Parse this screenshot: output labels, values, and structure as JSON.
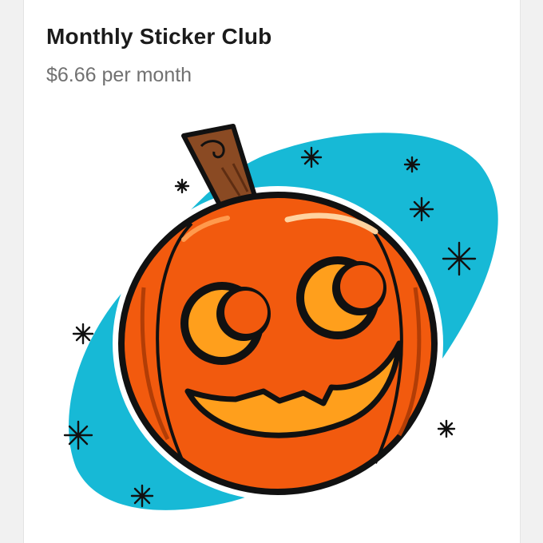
{
  "product": {
    "title": "Monthly Sticker Club",
    "price": "$6.66 per month"
  },
  "image": {
    "subject": "jack-o-lantern-sticker",
    "colors": {
      "background_blob": "#17b9d6",
      "pumpkin": "#f25a0e",
      "pumpkin_highlight": "#ff8a3a",
      "glow": "#ff9f1c",
      "stem": "#8a4a23",
      "outline": "#111111"
    }
  }
}
